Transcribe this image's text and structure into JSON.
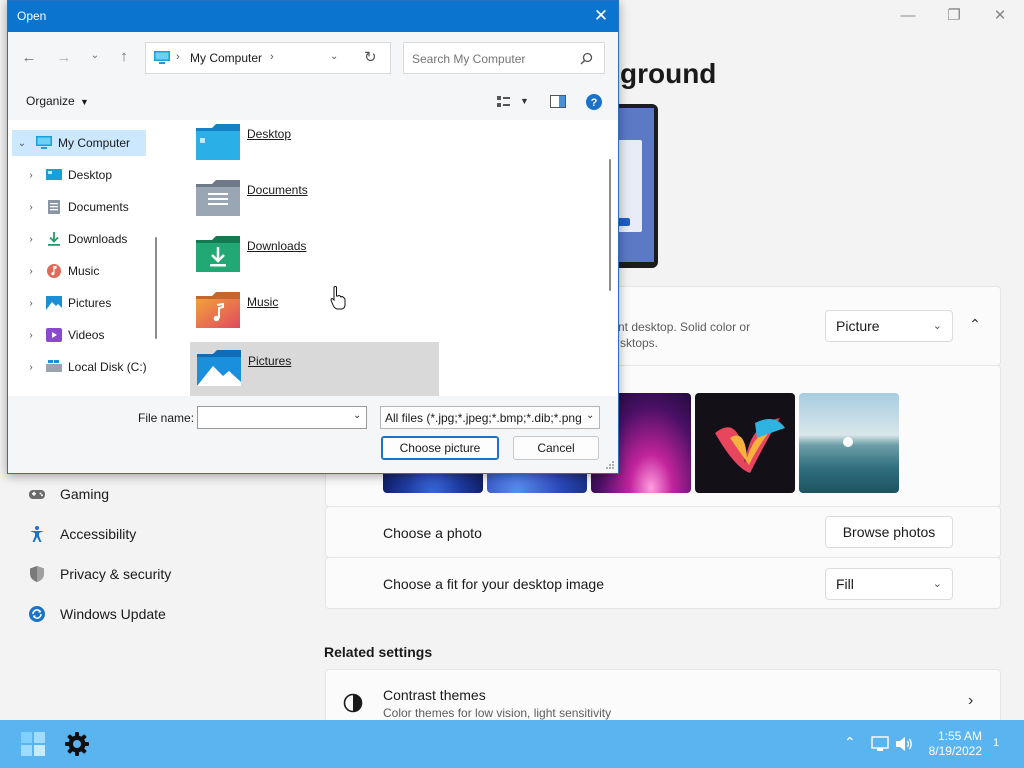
{
  "settings": {
    "page_title": "ground",
    "bg_desc_line1": "nt desktop. Solid color or",
    "bg_desc_line2": "sktops.",
    "bg_type_value": "Picture",
    "choose_photo_label": "Choose a photo",
    "browse_label": "Browse photos",
    "fit_label": "Choose a fit for your desktop image",
    "fit_value": "Fill",
    "related_title": "Related settings",
    "contrast_title": "Contrast themes",
    "contrast_desc": "Color themes for low vision, light sensitivity",
    "nav": [
      {
        "label": "Gaming"
      },
      {
        "label": "Accessibility"
      },
      {
        "label": "Privacy & security"
      },
      {
        "label": "Windows Update"
      }
    ]
  },
  "dialog": {
    "title": "Open",
    "address_label": "My Computer",
    "search_placeholder": "Search My Computer",
    "organize_label": "Organize",
    "tree": [
      {
        "label": "My Computer"
      },
      {
        "label": "Desktop"
      },
      {
        "label": "Documents"
      },
      {
        "label": "Downloads"
      },
      {
        "label": "Music"
      },
      {
        "label": "Pictures"
      },
      {
        "label": "Videos"
      },
      {
        "label": "Local Disk (C:)"
      }
    ],
    "folders": [
      {
        "label": "Desktop"
      },
      {
        "label": "Documents"
      },
      {
        "label": "Downloads"
      },
      {
        "label": "Music"
      },
      {
        "label": "Pictures"
      }
    ],
    "filename_label": "File name:",
    "filename_value": "",
    "filetype_value": "All files (*.jpg;*.jpeg;*.bmp;*.dib;*.png",
    "choose_button": "Choose picture",
    "cancel_button": "Cancel"
  },
  "taskbar": {
    "time": "1:55 AM",
    "date": "8/19/2022",
    "notification_count": "1"
  },
  "colors": {
    "taskbar": "#5ab4ef",
    "titlebar": "#0a74cf",
    "selection": "#cce8ff"
  }
}
